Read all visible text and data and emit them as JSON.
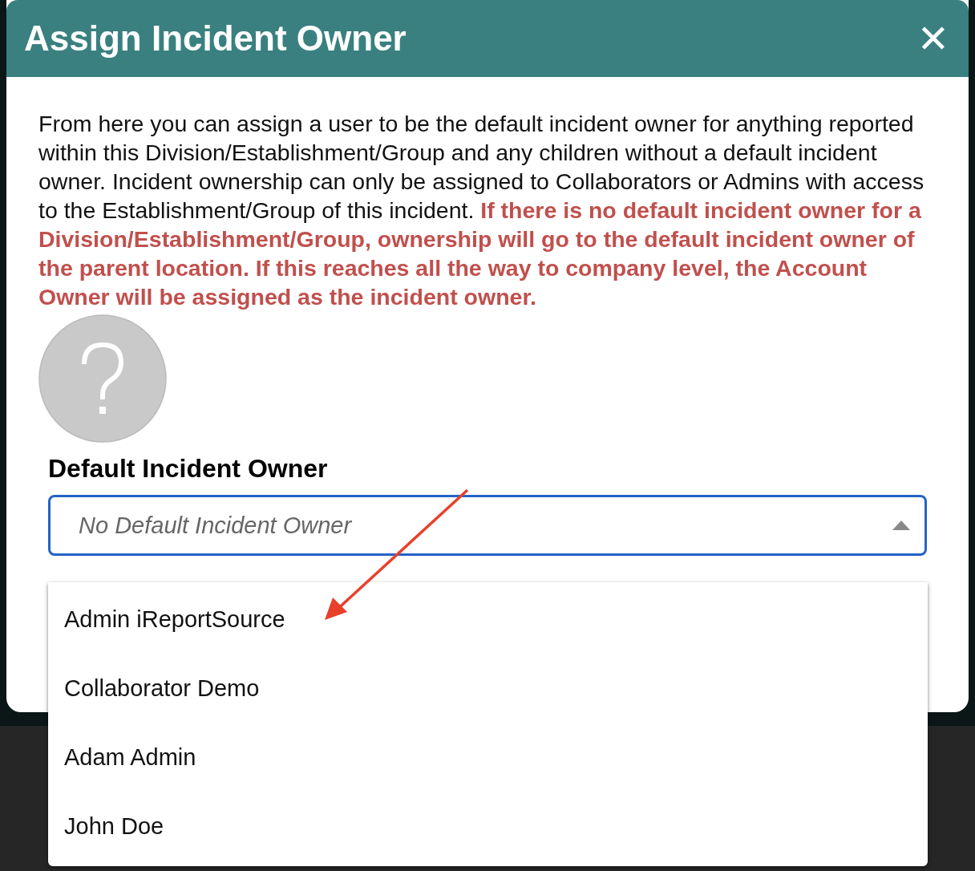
{
  "dialog": {
    "title": "Assign Incident Owner",
    "close": "✕"
  },
  "description": "From here you can assign a user to be the default incident owner for anything reported within this Division/Establishment/Group and any children without a default incident owner. Incident ownership can only be assigned to Collaborators or Admins with access to the Establishment/Group of this incident. **If there is no default incident owner for a Division/Establishment/Group, ownership will go to the default incident owner of the parent location. If this reaches all the way to company level, the Account Owner will be assigned as the incident owner.**",
  "owner_field": {
    "label": "Default Incident Owner",
    "placeholder": "No Default Incident Owner",
    "expanded": true,
    "options": [
      {
        "label": "Admin iReportSource",
        "selected": false
      },
      {
        "label": "Collaborator Demo",
        "selected": false
      },
      {
        "label": "Adam Admin",
        "selected": false
      },
      {
        "label": "John Doe",
        "selected": false
      }
    ]
  }
}
